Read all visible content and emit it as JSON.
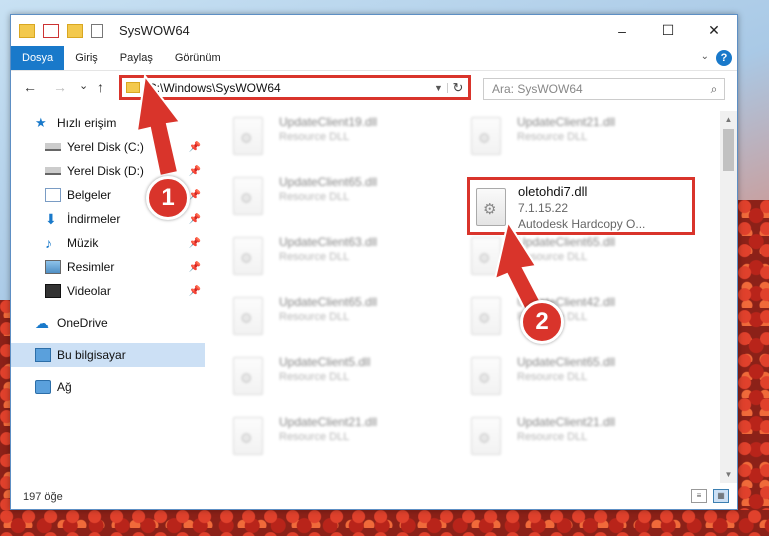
{
  "window": {
    "title": "SysWOW64",
    "controls": {
      "minimize": "–",
      "maximize": "☐",
      "close": "✕"
    }
  },
  "ribbon": {
    "tabs": [
      {
        "label": "Dosya",
        "active": true
      },
      {
        "label": "Giriş",
        "active": false
      },
      {
        "label": "Paylaş",
        "active": false
      },
      {
        "label": "Görünüm",
        "active": false
      }
    ],
    "help": "?"
  },
  "nav": {
    "back": "←",
    "forward": "→",
    "recent": "⌄",
    "up": "↑",
    "address": "C:\\Windows\\SysWOW64",
    "search_placeholder": "Ara: SysWOW64"
  },
  "sidebar": {
    "items": [
      {
        "label": "Hızlı erişim",
        "icon": "star-icon"
      },
      {
        "label": "Yerel Disk (C:)",
        "icon": "drive-icon",
        "pinned": true
      },
      {
        "label": "Yerel Disk (D:)",
        "icon": "drive-icon",
        "pinned": true
      },
      {
        "label": "Belgeler",
        "icon": "documents-icon",
        "pinned": true
      },
      {
        "label": "İndirmeler",
        "icon": "downloads-icon",
        "pinned": true
      },
      {
        "label": "Müzik",
        "icon": "music-icon",
        "pinned": true
      },
      {
        "label": "Resimler",
        "icon": "pictures-icon",
        "pinned": true
      },
      {
        "label": "Videolar",
        "icon": "videos-icon",
        "pinned": true
      },
      {
        "label": "OneDrive",
        "icon": "cloud-icon"
      },
      {
        "label": "Bu bilgisayar",
        "icon": "computer-icon",
        "selected": true
      },
      {
        "label": "Ağ",
        "icon": "network-icon"
      }
    ]
  },
  "files": [
    {
      "name": "UpdateClient19.dll",
      "desc": "Resource DLL"
    },
    {
      "name": "UpdateClient21.dll",
      "desc": "Resource DLL"
    },
    {
      "name": "UpdateClient65.dll",
      "desc": "Resource DLL"
    },
    {
      "name": "UpdateClient63.dll",
      "desc": "Resource DLL"
    },
    {
      "name": "UpdateClient65.dll",
      "desc": "Resource DLL"
    },
    {
      "name": "UpdateClient65.dll",
      "desc": "Resource DLL"
    },
    {
      "name": "UpdateClient42.dll",
      "desc": "Resource DLL"
    },
    {
      "name": "UpdateClient5.dll",
      "desc": "Resource DLL"
    },
    {
      "name": "UpdateClient65.dll",
      "desc": "Resource DLL"
    },
    {
      "name": "UpdateClient21.dll",
      "desc": "Resource DLL"
    },
    {
      "name": "UpdateClient21.dll",
      "desc": "Resource DLL"
    }
  ],
  "highlighted_file": {
    "name": "oletohdi7.dll",
    "version": "7.1.15.22",
    "desc": "Autodesk Hardcopy O..."
  },
  "status": {
    "count": "197 öğe"
  },
  "annotations": {
    "badge1": "1",
    "badge2": "2",
    "color": "#d9342b"
  }
}
